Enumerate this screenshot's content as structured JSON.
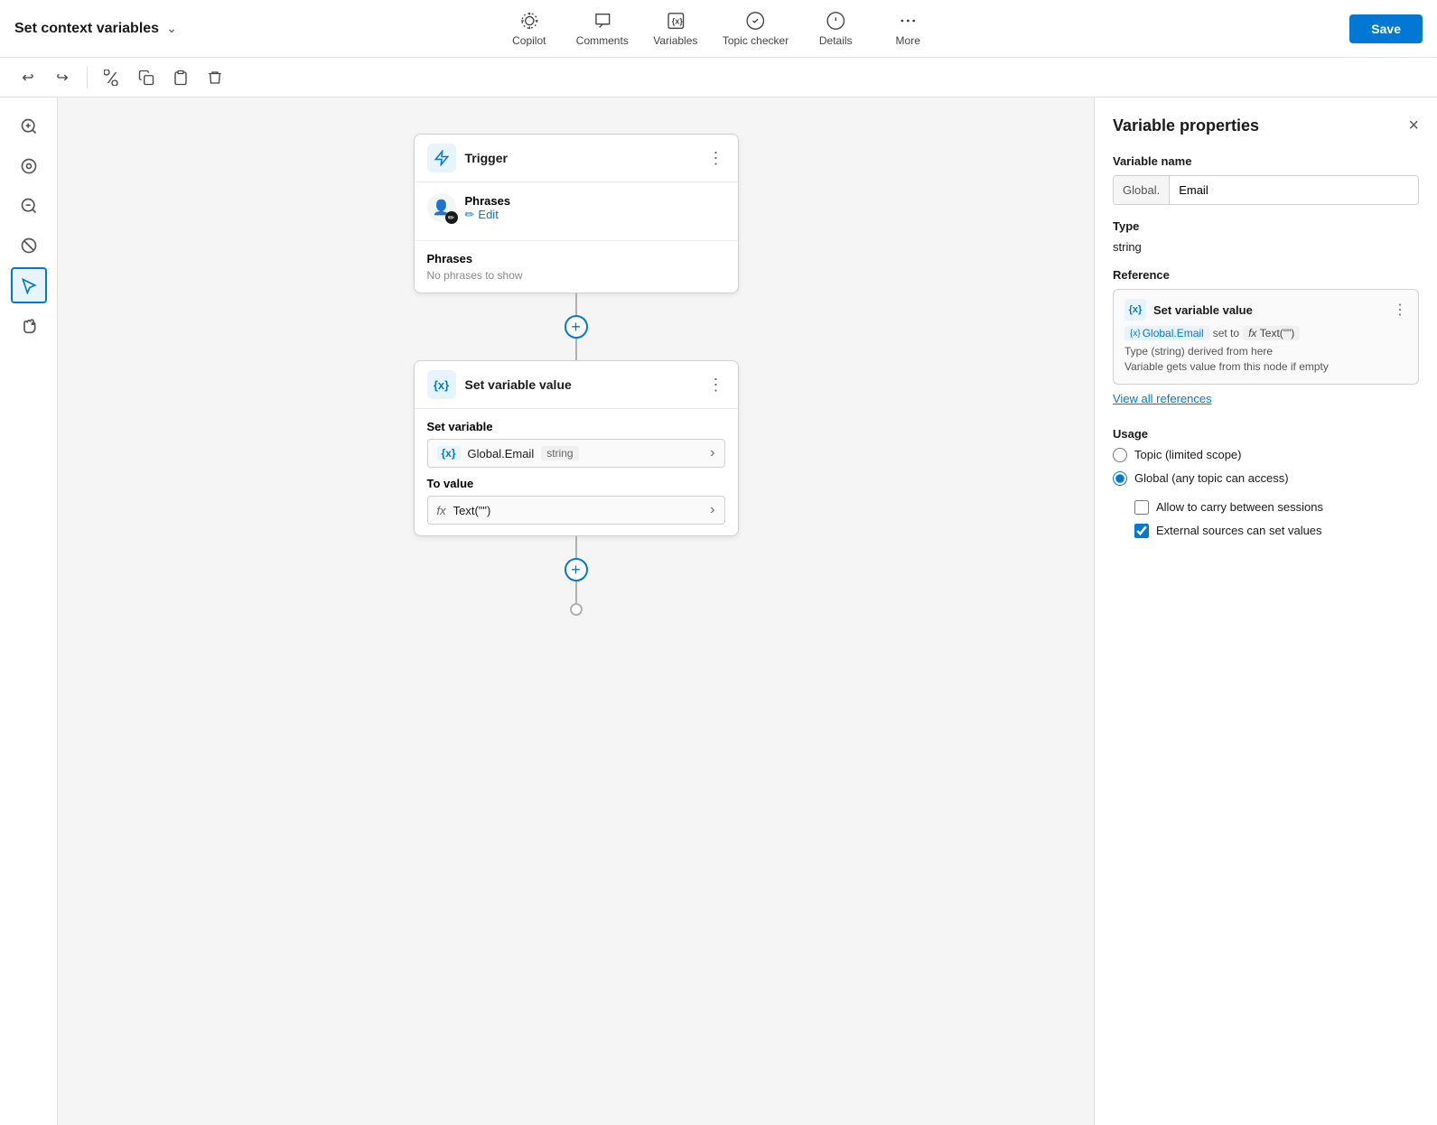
{
  "topbar": {
    "title": "Set context variables",
    "nav": [
      {
        "id": "copilot",
        "label": "Copilot",
        "icon": "copilot"
      },
      {
        "id": "comments",
        "label": "Comments",
        "icon": "comments"
      },
      {
        "id": "variables",
        "label": "Variables",
        "icon": "variables"
      },
      {
        "id": "topic-checker",
        "label": "Topic checker",
        "icon": "topic-checker"
      },
      {
        "id": "details",
        "label": "Details",
        "icon": "details"
      },
      {
        "id": "more",
        "label": "More",
        "icon": "more"
      }
    ],
    "save_label": "Save"
  },
  "toolbar": {
    "undo": "↩",
    "redo": "↪",
    "cut": "✂",
    "copy": "⧉",
    "paste": "📋",
    "delete": "🗑"
  },
  "flow": {
    "trigger_node": {
      "title": "Trigger",
      "phrases_title": "Phrases",
      "edit_label": "Edit",
      "phrases_empty": "No phrases to show"
    },
    "var_node": {
      "title": "Set variable value",
      "set_variable_label": "Set variable",
      "var_name": "Global.Email",
      "var_type": "string",
      "to_value_label": "To value",
      "fx_value": "Text(\"\")"
    }
  },
  "right_panel": {
    "title": "Variable properties",
    "variable_name_section": "Variable name",
    "prefix": "Global.",
    "var_name": "Email",
    "type_section": "Type",
    "type_value": "string",
    "reference_section": "Reference",
    "ref": {
      "title": "Set variable value",
      "var_label": "{x}",
      "var_name": "Global.Email",
      "set_to": "set to",
      "fx_label": "fx",
      "fx_value": "Text(\"\")",
      "note1": "Type (string) derived from here",
      "note2": "Variable gets value from this node if empty"
    },
    "view_refs_label": "View all references",
    "usage_section": "Usage",
    "radio_options": [
      {
        "id": "topic",
        "label": "Topic (limited scope)",
        "checked": false
      },
      {
        "id": "global",
        "label": "Global (any topic can access)",
        "checked": true
      }
    ],
    "checkboxes": [
      {
        "id": "carry",
        "label": "Allow to carry between sessions",
        "checked": false
      },
      {
        "id": "external",
        "label": "External sources can set values",
        "checked": true
      }
    ]
  },
  "side_tools": [
    {
      "id": "zoom-in",
      "icon": "⊕",
      "label": "zoom in"
    },
    {
      "id": "center",
      "icon": "◎",
      "label": "center"
    },
    {
      "id": "zoom-out",
      "icon": "⊖",
      "label": "zoom out"
    },
    {
      "id": "no-tool",
      "icon": "⊘",
      "label": "no tool"
    },
    {
      "id": "select",
      "icon": "↖",
      "label": "select",
      "active": true
    },
    {
      "id": "hand",
      "icon": "✋",
      "label": "hand"
    }
  ]
}
